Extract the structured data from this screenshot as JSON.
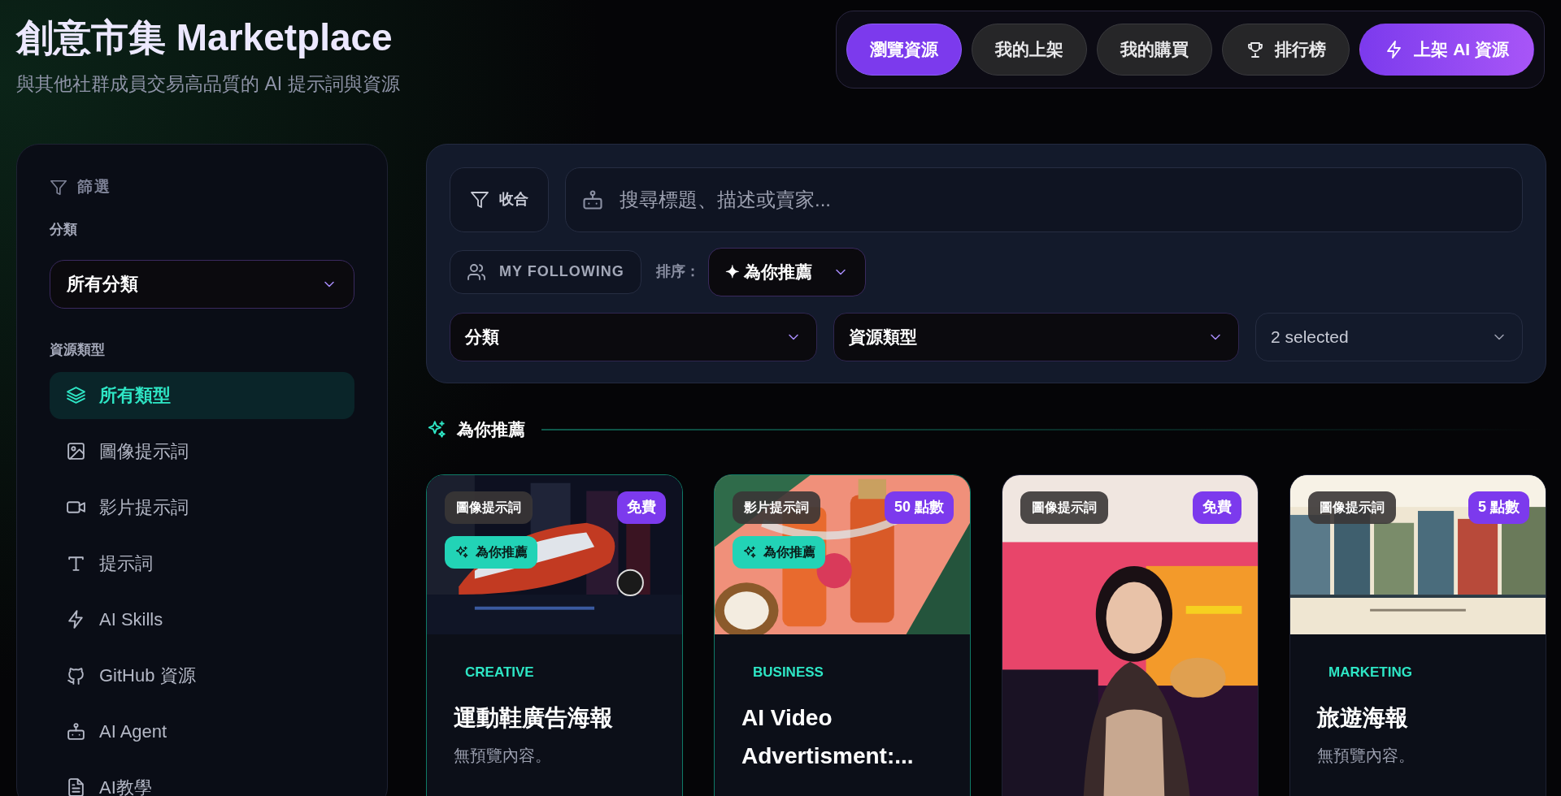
{
  "header": {
    "title": "創意市集 Marketplace",
    "subtitle": "與其他社群成員交易高品質的 AI 提示詞與資源"
  },
  "nav": {
    "tabs": [
      {
        "label": "瀏覽資源",
        "selected": true
      },
      {
        "label": "我的上架",
        "selected": false
      },
      {
        "label": "我的購買",
        "selected": false
      },
      {
        "label": "排行榜",
        "selected": false
      }
    ],
    "upload_button": "上架 AI 資源"
  },
  "sidebar": {
    "heading": "篩選",
    "category_label": "分類",
    "category_select": "所有分類",
    "type_label": "資源類型",
    "types": [
      {
        "label": "所有類型",
        "selected": true
      },
      {
        "label": "圖像提示詞",
        "selected": false
      },
      {
        "label": "影片提示詞",
        "selected": false
      },
      {
        "label": "提示詞",
        "selected": false
      },
      {
        "label": "AI Skills",
        "selected": false
      },
      {
        "label": "GitHub 資源",
        "selected": false
      },
      {
        "label": "AI Agent",
        "selected": false
      },
      {
        "label": "AI教學",
        "selected": false
      }
    ]
  },
  "toolbar": {
    "collapse_button": "收合",
    "search_placeholder": "搜尋標題、描述或賣家...",
    "following_button": "MY FOLLOWING",
    "sort_label": "排序：",
    "sort_value": "✦ 為你推薦",
    "selects": [
      {
        "label": "分類",
        "kind": "dark"
      },
      {
        "label": "資源類型",
        "kind": "dark"
      },
      {
        "label": "2 selected",
        "kind": "muted"
      }
    ]
  },
  "section": {
    "title": "為你推薦"
  },
  "cards": [
    {
      "type_tag": "圖像提示詞",
      "price": "免費",
      "recommended": true,
      "recommended_label": "為你推薦",
      "category": "CREATIVE",
      "title": "運動鞋廣告海報",
      "description": "無預覽內容。"
    },
    {
      "type_tag": "影片提示詞",
      "price": "50 點數",
      "recommended": true,
      "recommended_label": "為你推薦",
      "category": "BUSINESS",
      "title": "AI Video Advertisment:..."
    },
    {
      "type_tag": "圖像提示詞",
      "price": "免費",
      "recommended": false
    },
    {
      "type_tag": "圖像提示詞",
      "price": "5 點數",
      "recommended": false,
      "category": "MARKETING",
      "title": "旅遊海報",
      "description": "無預覽內容。"
    }
  ]
}
